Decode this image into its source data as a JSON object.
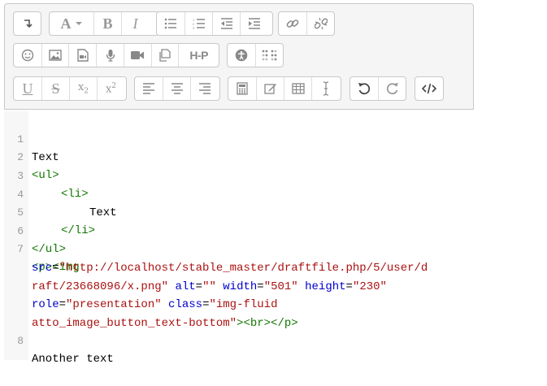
{
  "toolbar": {
    "row1": [
      {
        "name": "collapse-button",
        "icon": "collapse-arrow-icon"
      },
      {
        "name": "style-button",
        "icon": "font-style-icon",
        "label": "A"
      },
      {
        "name": "bold-button",
        "icon": "bold-icon",
        "label": "B"
      },
      {
        "name": "italic-button",
        "icon": "italic-icon",
        "label": "I"
      },
      {
        "name": "unordered-list-button",
        "icon": "unordered-list-icon"
      },
      {
        "name": "ordered-list-button",
        "icon": "ordered-list-icon"
      },
      {
        "name": "outdent-button",
        "icon": "outdent-icon"
      },
      {
        "name": "indent-button",
        "icon": "indent-icon"
      },
      {
        "name": "link-button",
        "icon": "link-icon"
      },
      {
        "name": "unlink-button",
        "icon": "unlink-icon"
      }
    ],
    "row2": [
      {
        "name": "emoticon-button",
        "icon": "emoticon-icon"
      },
      {
        "name": "image-button",
        "icon": "image-icon"
      },
      {
        "name": "media-button",
        "icon": "media-file-icon"
      },
      {
        "name": "record-audio-button",
        "icon": "microphone-icon"
      },
      {
        "name": "record-video-button",
        "icon": "video-camera-icon"
      },
      {
        "name": "manage-files-button",
        "icon": "files-icon"
      },
      {
        "name": "h5p-button",
        "icon": "h5p-icon",
        "label": "H-P"
      },
      {
        "name": "accessibility-checker-button",
        "icon": "accessibility-icon"
      },
      {
        "name": "screenreader-helper-button",
        "icon": "braille-icon"
      }
    ],
    "row3": [
      {
        "name": "underline-button",
        "icon": "underline-icon",
        "label": "U"
      },
      {
        "name": "strikethrough-button",
        "icon": "strikethrough-icon",
        "label": "S"
      },
      {
        "name": "subscript-button",
        "icon": "subscript-icon",
        "label": "x",
        "sub": "2"
      },
      {
        "name": "superscript-button",
        "icon": "superscript-icon",
        "label": "x",
        "sup": "2"
      },
      {
        "name": "align-left-button",
        "icon": "align-left-icon"
      },
      {
        "name": "align-center-button",
        "icon": "align-center-icon"
      },
      {
        "name": "align-right-button",
        "icon": "align-right-icon"
      },
      {
        "name": "equation-button",
        "icon": "calculator-icon"
      },
      {
        "name": "special-character-button",
        "icon": "pencil-icon"
      },
      {
        "name": "table-button",
        "icon": "table-icon"
      },
      {
        "name": "clear-formatting-button",
        "icon": "text-cursor-icon"
      },
      {
        "name": "undo-button",
        "icon": "undo-icon"
      },
      {
        "name": "redo-button",
        "icon": "redo-icon"
      },
      {
        "name": "html-button",
        "icon": "code-icon"
      }
    ]
  },
  "editor": {
    "line_numbers": [
      "1",
      "2",
      "3",
      "4",
      "5",
      "6",
      "7",
      "8"
    ],
    "lines": {
      "l1": "Text",
      "l2": "<ul>",
      "l3": "<li>",
      "l4": "Text",
      "l5": "</li>",
      "l6": "</ul>",
      "l7a_tag": "<p><img",
      "l7b_attr": "src",
      "l7b_eq": "=",
      "l7b_str": "\"http://localhost/stable_master/draftfile.php/5/user/d",
      "l7c_str": "raft/23668096/x.png\"",
      "l7c_attr1": "alt",
      "l7c_str1": "\"\"",
      "l7c_attr2": "width",
      "l7c_str2": "\"501\"",
      "l7c_attr3": "height",
      "l7c_str3": "\"230\"",
      "l7d_attr1": "role",
      "l7d_str1": "\"presentation\"",
      "l7d_attr2": "class",
      "l7d_str2": "\"img-fluid",
      "l7e_str": "atto_image_button_text-bottom\"",
      "l7e_tag": "><br></p>",
      "l8": "Another text"
    }
  }
}
